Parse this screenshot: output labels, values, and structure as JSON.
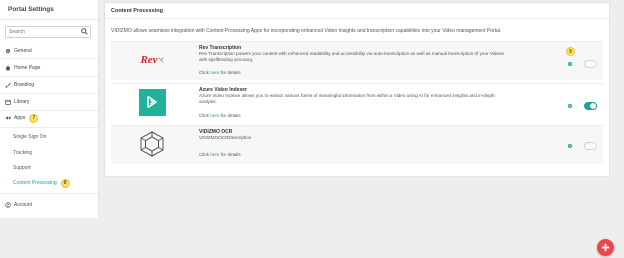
{
  "sidebar": {
    "title": "Portal Settings",
    "search_placeholder": "Search",
    "items": {
      "general": "General",
      "home_page": "Home Page",
      "branding": "Branding",
      "library": "Library",
      "apps": "Apps",
      "account": "Account"
    },
    "apps_badge": "7",
    "sub_items": {
      "sso": "Single Sign On",
      "tracking": "Tracking",
      "support": "Support",
      "content_processing": "Content Processing"
    },
    "content_processing_badge": "8"
  },
  "main": {
    "title": "Content Processing",
    "description": "VIDIZMO allows seamless integration with Content Processing Apps for incorporating enhanced Video Insights and transcription capabilities into your Video management Portal.",
    "apps": [
      {
        "logo_text": "Rev",
        "name": "Rev Transcription",
        "description": "Rev Transcription powers your content with enhanced readability and accessibility via auto-transcription as well as manual transcription of your Videos with spellbinding accuracy.",
        "link_prefix": "Click ",
        "link_text": "here",
        "link_suffix": " for details",
        "badge": "9",
        "enabled": false
      },
      {
        "name": "Azure Video Indexer",
        "description": "Azure Video Indexer allows you to extract various forms of meaningful information from within a Video using AI for enhanced insights and in-depth analysis.",
        "link_prefix": "Click ",
        "link_text": "here",
        "link_suffix": " for details",
        "enabled": true
      },
      {
        "name": "VIDIZMO OCR",
        "description": "VIDIZMOOCRDescription",
        "link_prefix": "Click ",
        "link_text": "here",
        "link_suffix": " for details",
        "enabled": false
      }
    ]
  },
  "colors": {
    "accent": "#1aa39c",
    "fab": "#f0454b",
    "badge": "#f9e26a",
    "azure": "#21b29e",
    "rev": "#d8232a"
  },
  "icons": [
    "search-icon",
    "gear-icon",
    "home-icon",
    "brush-icon",
    "library-icon",
    "apps-icon",
    "user-icon",
    "plus-icon"
  ]
}
